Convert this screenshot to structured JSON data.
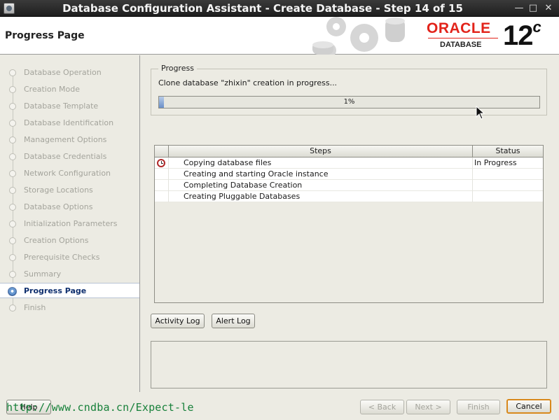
{
  "window": {
    "title": "Database Configuration Assistant - Create Database - Step 14 of 15",
    "minimize": "—",
    "maximize": "□",
    "close": "✕"
  },
  "header": {
    "page_heading": "Progress Page",
    "brand": "ORACLE",
    "product": "DATABASE",
    "version": "12",
    "version_suffix": "c"
  },
  "sidebar": {
    "items": [
      {
        "label": "Database Operation"
      },
      {
        "label": "Creation Mode"
      },
      {
        "label": "Database Template"
      },
      {
        "label": "Database Identification"
      },
      {
        "label": "Management Options"
      },
      {
        "label": "Database Credentials"
      },
      {
        "label": "Network Configuration"
      },
      {
        "label": "Storage Locations"
      },
      {
        "label": "Database Options"
      },
      {
        "label": "Initialization Parameters"
      },
      {
        "label": "Creation Options"
      },
      {
        "label": "Prerequisite Checks"
      },
      {
        "label": "Summary"
      },
      {
        "label": "Progress Page"
      },
      {
        "label": "Finish"
      }
    ],
    "active_index": 13
  },
  "progress": {
    "group_title": "Progress",
    "message": "Clone database \"zhixin\" creation in progress...",
    "percent_text": "1%",
    "fraction": 0.01
  },
  "steps_table": {
    "headers": [
      "Steps",
      "Status"
    ],
    "rows": [
      {
        "step": "Copying database files",
        "status": "In Progress",
        "icon": "clock-icon"
      },
      {
        "step": "Creating and starting Oracle instance",
        "status": ""
      },
      {
        "step": "Completing Database Creation",
        "status": ""
      },
      {
        "step": "Creating Pluggable Databases",
        "status": ""
      }
    ]
  },
  "buttons": {
    "activity_log": "Activity Log",
    "alert_log": "Alert Log",
    "help": "Help",
    "back": "< Back",
    "next": "Next >",
    "finish": "Finish",
    "cancel": "Cancel"
  },
  "watermark": "http://www.cndba.cn/Expect-le",
  "colors": {
    "oracle_red": "#e2231a",
    "accent_blue": "#0f2f6e",
    "default_button_border": "#d8891c",
    "watermark_green": "#17803a"
  }
}
